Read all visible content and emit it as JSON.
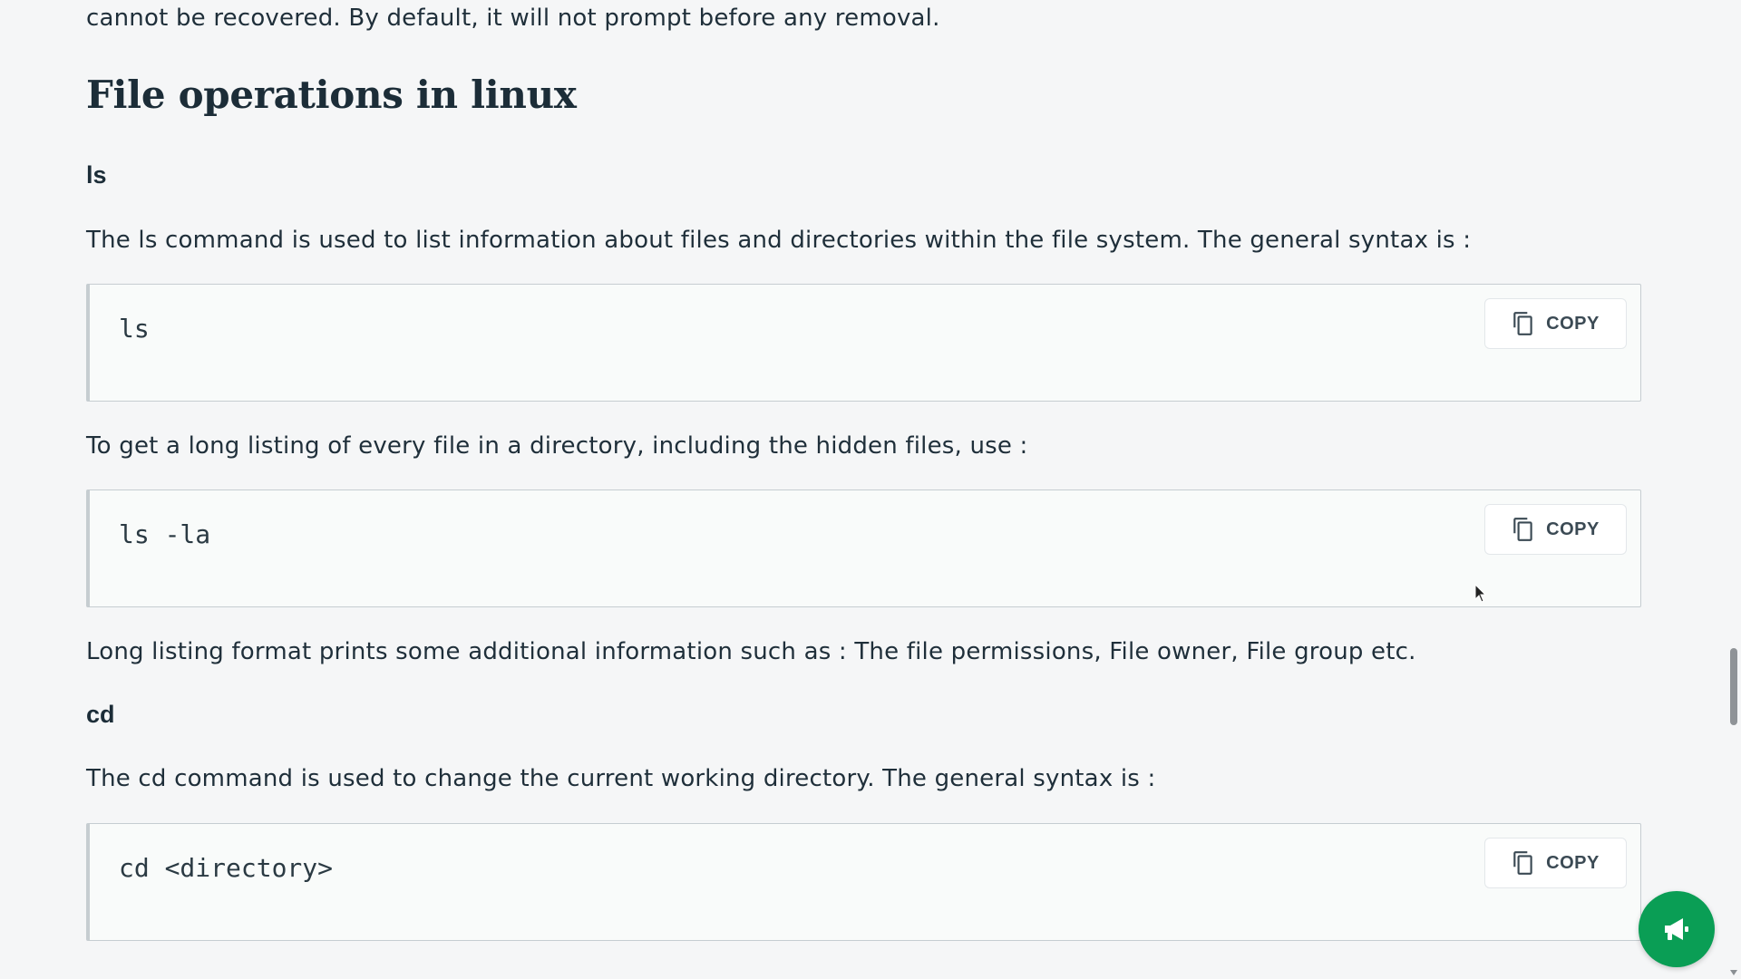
{
  "article": {
    "intro_tail": "cannot be recovered. By default, it will not prompt before any removal.",
    "section_title": "File operations in linux",
    "ls": {
      "heading": "ls",
      "description": "The ls command is used to list information about files and directories within the file system. The general syntax is :",
      "code": "ls",
      "long_listing_intro": "To get a long listing of every file in a directory, including the hidden files, use :",
      "long_listing_code": "ls -la",
      "long_listing_note": "Long listing format prints some additional information such as : The file permissions, File owner, File group etc."
    },
    "cd": {
      "heading": "cd",
      "description": "The cd command is used to change the current working directory. The general syntax is :",
      "code": "cd <directory>"
    }
  },
  "copy_button": {
    "label": "COPY",
    "icon": "copy-icon"
  },
  "fab": {
    "icon": "megaphone-icon",
    "color": "#0a9e55"
  },
  "colors": {
    "background": "#f5f6f7",
    "code_background": "#f9fbfa",
    "text": "#1c2d38"
  }
}
